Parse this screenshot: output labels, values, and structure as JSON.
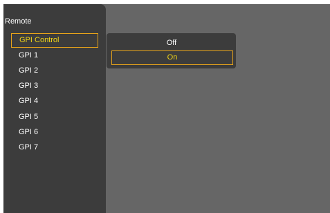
{
  "sidebar": {
    "title": "Remote",
    "items": [
      {
        "label": "GPI Control",
        "selected": true
      },
      {
        "label": "GPI 1",
        "selected": false
      },
      {
        "label": "GPI 2",
        "selected": false
      },
      {
        "label": "GPI 3",
        "selected": false
      },
      {
        "label": "GPI 4",
        "selected": false
      },
      {
        "label": "GPI 5",
        "selected": false
      },
      {
        "label": "GPI 6",
        "selected": false
      },
      {
        "label": "GPI 7",
        "selected": false
      }
    ]
  },
  "popup": {
    "options": [
      {
        "label": "Off",
        "selected": false
      },
      {
        "label": "On",
        "selected": true
      }
    ]
  },
  "colors": {
    "background": "#666666",
    "panel": "#3c3c3c",
    "highlight_border": "#e8a41a",
    "highlight_text": "#f0d418",
    "text": "#ffffff"
  }
}
